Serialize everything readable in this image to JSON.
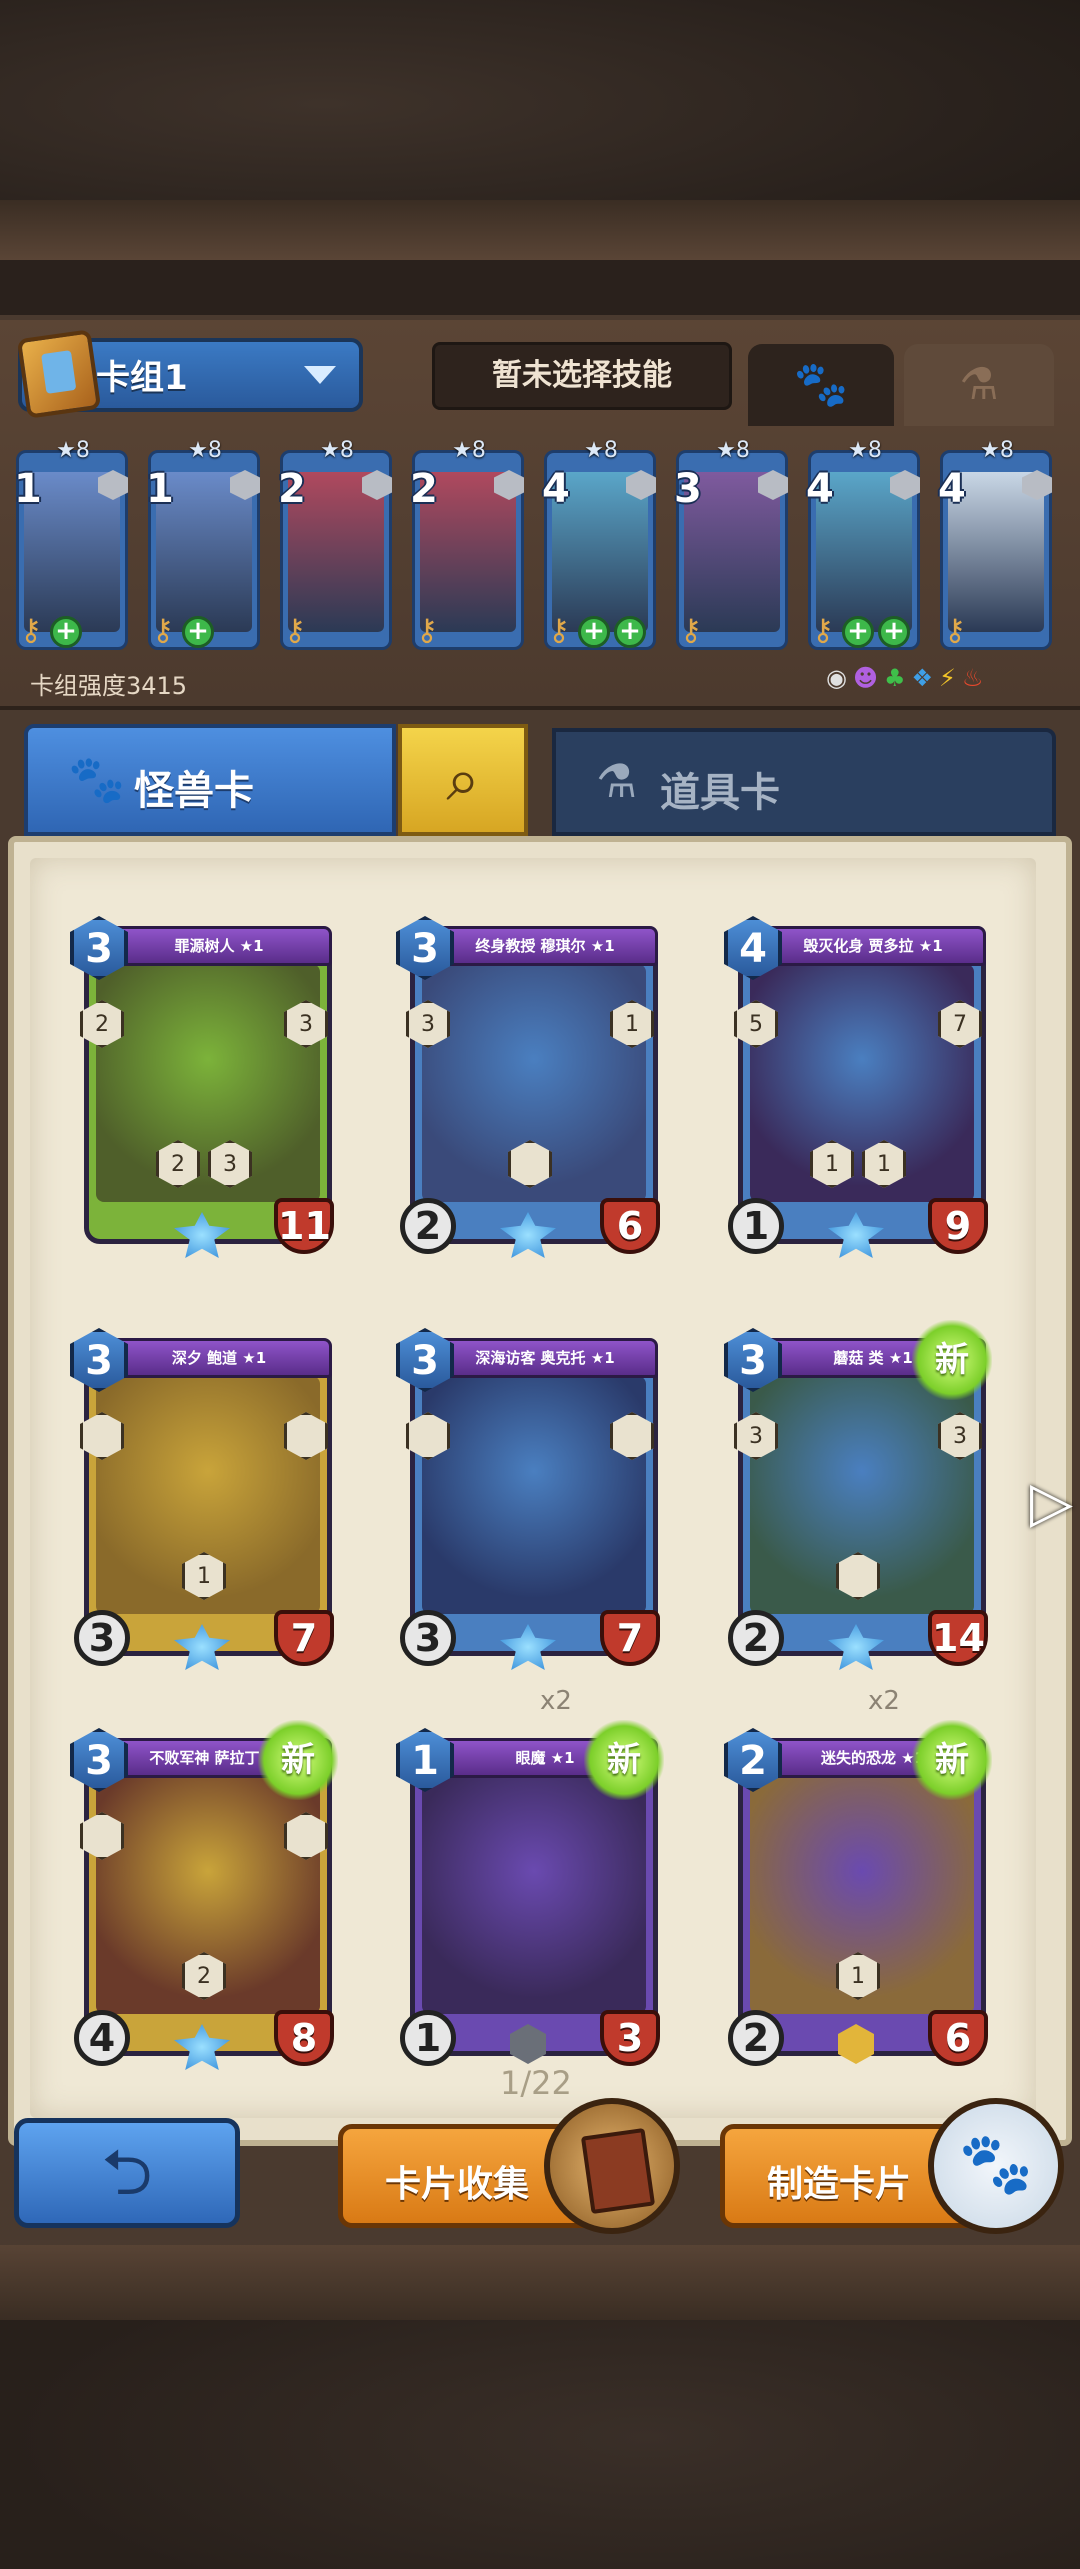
{
  "header": {
    "deck_name": "卡组1",
    "skill_button": "暂未选择技能",
    "tab_beast_icon": "paw-icon",
    "tab_item_icon": "potion-icon"
  },
  "deck": {
    "strength_label": "卡组强度3415",
    "cards": [
      {
        "star": "★8",
        "cost": "1",
        "plus_count": 1,
        "color": "#6a8bc9"
      },
      {
        "star": "★8",
        "cost": "1",
        "plus_count": 1,
        "color": "#6a8bc9"
      },
      {
        "star": "★8",
        "cost": "2",
        "plus_count": 0,
        "color": "#b0495e"
      },
      {
        "star": "★8",
        "cost": "2",
        "plus_count": 0,
        "color": "#b0495e"
      },
      {
        "star": "★8",
        "cost": "4",
        "plus_count": 2,
        "color": "#5aa6c9"
      },
      {
        "star": "★8",
        "cost": "3",
        "plus_count": 0,
        "color": "#7f5a9e"
      },
      {
        "star": "★8",
        "cost": "4",
        "plus_count": 2,
        "color": "#5aa6c9"
      },
      {
        "star": "★8",
        "cost": "4",
        "plus_count": 0,
        "color": "#c9d7e6"
      }
    ],
    "elements": [
      "◉",
      "☻",
      "♣",
      "❖",
      "⚡",
      "♨"
    ]
  },
  "tabs": {
    "beast": "怪兽卡",
    "item": "道具卡"
  },
  "cards": [
    {
      "cost": "3",
      "title": "罪源树人 ★1",
      "atk": "",
      "hp": "11",
      "abilities": [
        "2",
        "3"
      ],
      "bottom_abilities": [
        "2",
        "3"
      ],
      "count": "",
      "new": false,
      "gem": "blue",
      "frame": "#7cb33a",
      "art": "#4f5f2a"
    },
    {
      "cost": "3",
      "title": "终身教授 穆琪尔 ★1",
      "atk": "2",
      "hp": "6",
      "abilities": [
        "3",
        "1"
      ],
      "bottom_abilities": [
        ""
      ],
      "count": "",
      "new": false,
      "gem": "blue",
      "frame": "#4a7fc0",
      "art": "#3a4a7a"
    },
    {
      "cost": "4",
      "title": "毁灭化身 贾多拉 ★1",
      "atk": "1",
      "hp": "9",
      "abilities": [
        "5",
        "7"
      ],
      "bottom_abilities": [
        "1",
        "1"
      ],
      "count": "",
      "new": false,
      "gem": "blue",
      "frame": "#4a7fc0",
      "art": "#3a2a5a"
    },
    {
      "cost": "3",
      "title": "深夕 鲍道 ★1",
      "atk": "3",
      "hp": "7",
      "abilities": [
        "",
        ""
      ],
      "bottom_abilities": [
        "1"
      ],
      "count": "",
      "new": false,
      "gem": "blue",
      "frame": "#c9a43a",
      "art": "#8a6a2a"
    },
    {
      "cost": "3",
      "title": "深海访客 奥克托 ★1",
      "atk": "3",
      "hp": "7",
      "abilities": [
        "",
        ""
      ],
      "bottom_abilities": [],
      "count": "",
      "new": false,
      "gem": "blue",
      "frame": "#4a7fc0",
      "art": "#2a3a6a"
    },
    {
      "cost": "3",
      "title": "蘑菇 类 ★1",
      "atk": "2",
      "hp": "14",
      "abilities": [
        "3",
        "3"
      ],
      "bottom_abilities": [
        ""
      ],
      "count": "",
      "new": true,
      "new_label": "新",
      "gem": "blue",
      "frame": "#4a7fc0",
      "art": "#3a5a4a"
    },
    {
      "cost": "3",
      "title": "不败军神 萨拉丁 ★1",
      "atk": "4",
      "hp": "8",
      "abilities": [
        "",
        ""
      ],
      "bottom_abilities": [
        "2"
      ],
      "count": "",
      "new": true,
      "new_label": "新",
      "gem": "blue",
      "frame": "#c9a43a",
      "art": "#6a3a2a"
    },
    {
      "cost": "1",
      "title": "眼魔 ★1",
      "atk": "1",
      "hp": "3",
      "abilities": [],
      "bottom_abilities": [],
      "count": "x2",
      "new": true,
      "new_label": "新",
      "gem": "grey",
      "frame": "#6a4ab0",
      "art": "#3a2a5a"
    },
    {
      "cost": "2",
      "title": "迷失的恐龙 ★1",
      "atk": "2",
      "hp": "6",
      "abilities": [],
      "bottom_abilities": [
        "1"
      ],
      "count": "x2",
      "new": true,
      "new_label": "新",
      "gem": "gold",
      "frame": "#6a4ab0",
      "art": "#8a6a3a"
    }
  ],
  "pagination": {
    "label": "1/22"
  },
  "footer": {
    "back_icon": "back-arrow-icon",
    "collect_label": "卡片收集",
    "craft_label": "制造卡片"
  }
}
